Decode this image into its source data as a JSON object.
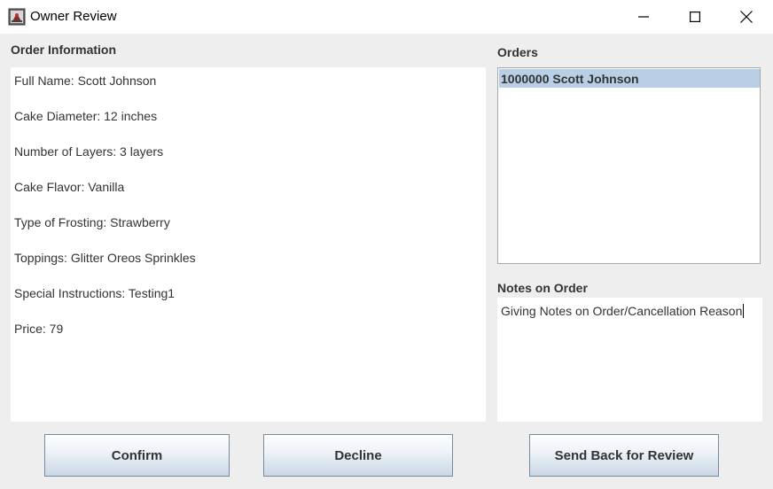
{
  "window": {
    "title": "Owner Review",
    "controls": [
      "minimize-icon",
      "maximize-icon",
      "close-icon"
    ]
  },
  "order_info": {
    "heading": "Order Information",
    "lines": [
      "Full Name: Scott Johnson",
      "Cake Diameter: 12 inches",
      "Number of Layers: 3 layers",
      "Cake Flavor: Vanilla",
      "Type of Frosting: Strawberry",
      "Toppings: Glitter Oreos Sprinkles",
      "Special Instructions: Testing1",
      "Price: 79"
    ]
  },
  "orders": {
    "heading": "Orders",
    "items": [
      "1000000 Scott Johnson"
    ],
    "selected_index": 0
  },
  "notes": {
    "heading": "Notes on Order",
    "value": "Giving Notes on Order/Cancellation Reason"
  },
  "buttons": {
    "confirm": "Confirm",
    "decline": "Decline",
    "send_back": "Send Back for Review"
  },
  "colors": {
    "selection": "#b8cfe5",
    "background": "#eeeeee"
  }
}
